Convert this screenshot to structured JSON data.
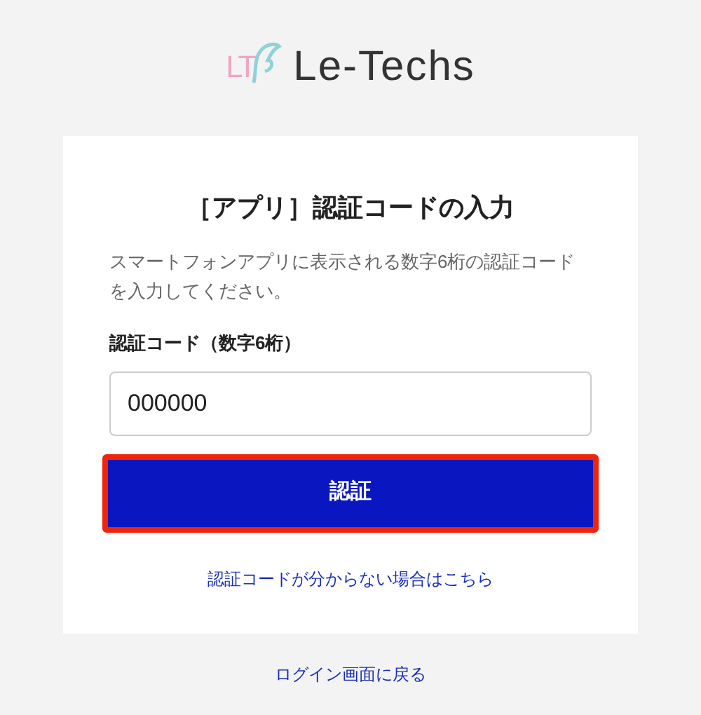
{
  "logo": {
    "mark": "LT",
    "name": "Le-Techs"
  },
  "card": {
    "title": "［アプリ］認証コードの入力",
    "description": "スマートフォンアプリに表示される数字6桁の認証コードを入力してください。",
    "field": {
      "label": "認証コード（数字6桁）",
      "value": "000000"
    },
    "submit": {
      "label": "認証",
      "highlighted": true
    },
    "help_link": "認証コードが分からない場合はこちら"
  },
  "back_link": "ログイン画面に戻る"
}
